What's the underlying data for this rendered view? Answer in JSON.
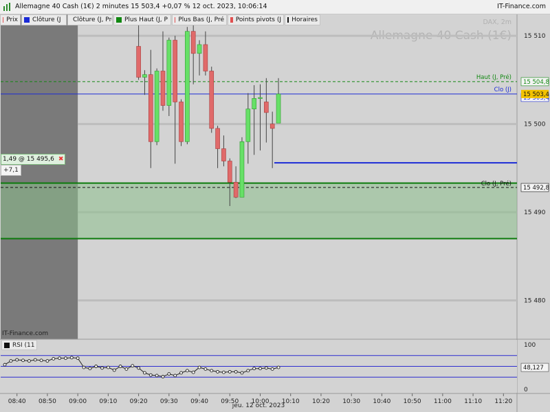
{
  "header": {
    "title": "Allemagne 40 Cash (1€) 2 minutes 15 503,4 +0,07 % 12 oct. 2023, 10:06:14",
    "brand": "IT-Finance.com"
  },
  "legend": [
    {
      "label": "Prix",
      "color": "#e05050",
      "width": 30
    },
    {
      "label": "Clôture (J",
      "color": "#1a2ad6",
      "width": 66
    },
    {
      "label": "Clôture (J, Pré",
      "color": "#111111",
      "width": 66
    },
    {
      "label": "Plus Haut (J, P",
      "color": "#118811",
      "width": 84
    },
    {
      "label": "Plus Bas (J, Pré",
      "color": "#e05050",
      "width": 80
    },
    {
      "label": "Points pivots (J",
      "color": "#e05050",
      "width": 82
    },
    {
      "label": "Horaires",
      "color": "#111111",
      "width": 52
    }
  ],
  "watermark": {
    "symbol": "DAX, 2m",
    "name": "Allemagne 40 Cash (1€)"
  },
  "bottom_brand": "IT-Finance.com",
  "trade": {
    "label": "1,49 @ 15 495,6",
    "pl": "+7,1",
    "close_icon": "✖"
  },
  "rsi_label": "RSI (11",
  "date_label": "jeu. 12 oct. 2023",
  "chart_data": [
    {
      "type": "candlestick",
      "timeframe": "2m",
      "ylim": [
        15475.6,
        15512.5
      ],
      "y_ticks": [
        15480,
        15490,
        15500,
        15510
      ],
      "y_tick_labels": [
        "15 480",
        "15 490",
        "15 500",
        "15 510"
      ],
      "x_ticks": [
        "08:40",
        "08:50",
        "09:00",
        "09:10",
        "09:20",
        "09:30",
        "09:40",
        "09:50",
        "10:00",
        "10:10",
        "10:20",
        "10:30",
        "10:40",
        "10:50",
        "11:00",
        "11:10",
        "11:20"
      ],
      "x_start": "08:36",
      "x_end": "11:24",
      "session_shade_until": "09:00",
      "candles": [
        {
          "t": "09:20",
          "o": 15508.8,
          "h": 15512.5,
          "l": 15505.0,
          "c": 15505.3
        },
        {
          "t": "09:22",
          "o": 15505.3,
          "h": 15506.1,
          "l": 15503.3,
          "c": 15505.6
        },
        {
          "t": "09:24",
          "o": 15505.6,
          "h": 15508.4,
          "l": 15495.0,
          "c": 15498.0
        },
        {
          "t": "09:26",
          "o": 15498.0,
          "h": 15506.3,
          "l": 15497.6,
          "c": 15506.0
        },
        {
          "t": "09:28",
          "o": 15506.0,
          "h": 15510.5,
          "l": 15501.5,
          "c": 15502.1
        },
        {
          "t": "09:30",
          "o": 15502.1,
          "h": 15509.8,
          "l": 15500.9,
          "c": 15509.5
        },
        {
          "t": "09:32",
          "o": 15509.5,
          "h": 15510.0,
          "l": 15495.5,
          "c": 15502.5
        },
        {
          "t": "09:34",
          "o": 15502.5,
          "h": 15502.8,
          "l": 15497.5,
          "c": 15498.0
        },
        {
          "t": "09:36",
          "o": 15498.0,
          "h": 15511.0,
          "l": 15497.7,
          "c": 15510.5
        },
        {
          "t": "09:38",
          "o": 15510.5,
          "h": 15511.2,
          "l": 15504.5,
          "c": 15508.0
        },
        {
          "t": "09:40",
          "o": 15508.0,
          "h": 15509.5,
          "l": 15505.5,
          "c": 15509.0
        },
        {
          "t": "09:42",
          "o": 15509.0,
          "h": 15510.5,
          "l": 15505.5,
          "c": 15506.0
        },
        {
          "t": "09:44",
          "o": 15506.0,
          "h": 15506.5,
          "l": 15499.0,
          "c": 15499.5
        },
        {
          "t": "09:46",
          "o": 15499.5,
          "h": 15499.8,
          "l": 15495.0,
          "c": 15497.2
        },
        {
          "t": "09:48",
          "o": 15497.2,
          "h": 15498.7,
          "l": 15495.2,
          "c": 15495.8
        },
        {
          "t": "09:50",
          "o": 15495.8,
          "h": 15496.1,
          "l": 15490.7,
          "c": 15493.4
        },
        {
          "t": "09:52",
          "o": 15493.4,
          "h": 15495.2,
          "l": 15491.6,
          "c": 15491.7
        },
        {
          "t": "09:54",
          "o": 15491.7,
          "h": 15498.5,
          "l": 15491.7,
          "c": 15498.0
        },
        {
          "t": "09:56",
          "o": 15498.0,
          "h": 15503.5,
          "l": 15495.5,
          "c": 15501.7
        },
        {
          "t": "09:58",
          "o": 15501.7,
          "h": 15504.4,
          "l": 15496.5,
          "c": 15502.9
        },
        {
          "t": "10:00",
          "o": 15502.9,
          "h": 15504.5,
          "l": 15497.0,
          "c": 15503.0
        },
        {
          "t": "10:02",
          "o": 15502.5,
          "h": 15505.2,
          "l": 15497.9,
          "c": 15501.3
        },
        {
          "t": "10:04",
          "o": 15500.0,
          "h": 15501.4,
          "l": 15495.0,
          "c": 15499.5
        },
        {
          "t": "10:06",
          "o": 15500.1,
          "h": 15505.2,
          "l": 15500.1,
          "c": 15503.4
        }
      ],
      "reference_lines": [
        {
          "name": "Haut (J, Pré)",
          "value": 15504.8,
          "label": "15 504,8",
          "color": "#118811",
          "style": "dashed"
        },
        {
          "name": "Clo (J)",
          "value": 15503.4,
          "label": "15 503,4",
          "color": "#1a2ad6",
          "style": "solid"
        },
        {
          "name": "Clo (J, Pré)",
          "value": 15492.8,
          "label": "15 492,8",
          "color": "#111111",
          "style": "dashed"
        },
        {
          "name": "",
          "value": 15495.6,
          "label": "",
          "color": "#1a2ad6",
          "style": "solid",
          "from": "10:06"
        }
      ],
      "last_price_label": "15 503,4",
      "zone": {
        "from": 15487.0,
        "to": 15493.3
      }
    },
    {
      "type": "line",
      "name": "RSI (11",
      "ylim": [
        0,
        100
      ],
      "y_ticks": [
        0,
        100
      ],
      "y_tick_labels": [
        "0",
        "100"
      ],
      "levels": [
        70,
        50,
        30
      ],
      "last_label": "48,127",
      "x": [
        "08:36",
        "08:38",
        "08:40",
        "08:42",
        "08:44",
        "08:46",
        "08:48",
        "08:50",
        "08:52",
        "08:54",
        "08:56",
        "08:58",
        "09:00",
        "09:02",
        "09:04",
        "09:06",
        "09:08",
        "09:10",
        "09:12",
        "09:14",
        "09:16",
        "09:18",
        "09:20",
        "09:22",
        "09:24",
        "09:26",
        "09:28",
        "09:30",
        "09:32",
        "09:34",
        "09:36",
        "09:38",
        "09:40",
        "09:42",
        "09:44",
        "09:46",
        "09:48",
        "09:50",
        "09:52",
        "09:54",
        "09:56",
        "09:58",
        "10:00",
        "10:02",
        "10:04",
        "10:06"
      ],
      "values": [
        53,
        60,
        62,
        61,
        60,
        62,
        61,
        60,
        64,
        65,
        65,
        66,
        65,
        48,
        46,
        50,
        47,
        48,
        43,
        50,
        45,
        51,
        47,
        38,
        34,
        33,
        31,
        36,
        33,
        38,
        42,
        39,
        48,
        45,
        42,
        40,
        39,
        40,
        40,
        38,
        42,
        46,
        46,
        47,
        45,
        48
      ]
    }
  ]
}
